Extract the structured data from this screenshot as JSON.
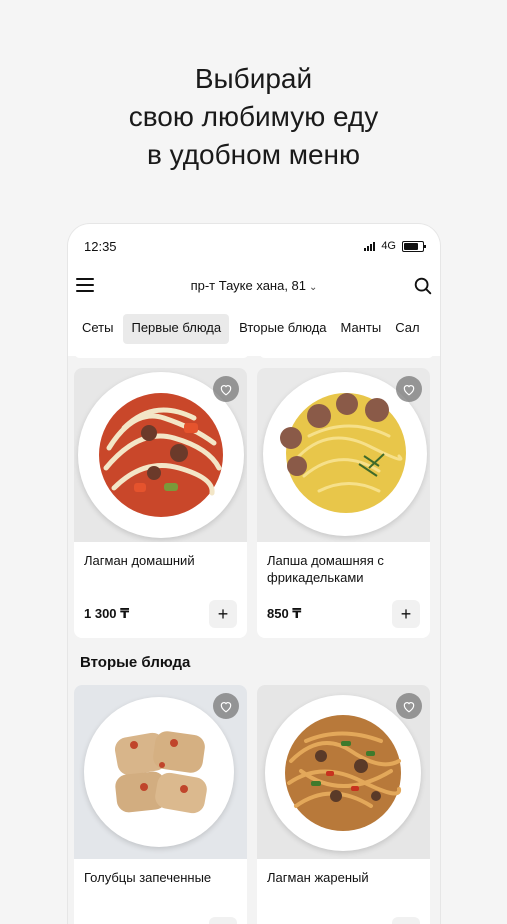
{
  "headline": {
    "line1": "Выбирай",
    "line2": "свою любимую еду",
    "line3": "в удобном меню"
  },
  "status_bar": {
    "time": "12:35",
    "network": "4G"
  },
  "header": {
    "address": "пр-т Тауке хана, 81",
    "menu_icon": "hamburger-icon",
    "search_icon": "search-icon"
  },
  "tabs": [
    {
      "label": "Сеты",
      "active": false
    },
    {
      "label": "Первые блюда",
      "active": true
    },
    {
      "label": "Вторые блюда",
      "active": false
    },
    {
      "label": "Манты",
      "active": false
    },
    {
      "label": "Сал",
      "active": false
    }
  ],
  "sections": {
    "first": {
      "items": [
        {
          "name": "Лагман домашний",
          "price": "1 300 ₸"
        },
        {
          "name": "Лапша домашняя с фрикадельками",
          "price": "850 ₸"
        }
      ]
    },
    "second": {
      "title": "Вторые блюда",
      "items": [
        {
          "name": "Голубцы запеченные"
        },
        {
          "name": "Лагман жареный"
        }
      ]
    }
  },
  "add_symbol": "+",
  "colors": {
    "background": "#f5f5f5",
    "card": "#ffffff",
    "active_tab": "#eaeaea",
    "favorite_bg": "#787878"
  }
}
